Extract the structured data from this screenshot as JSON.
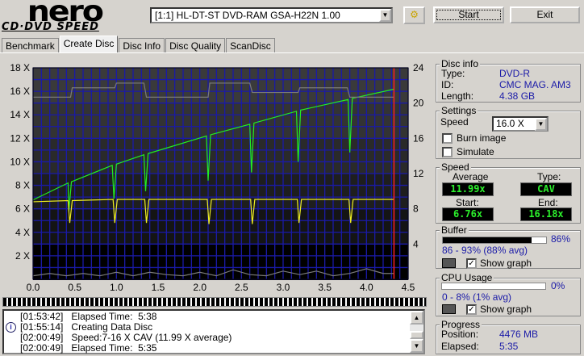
{
  "logo": {
    "line1": "nero",
    "line2": "CD·DVD SPEED"
  },
  "toolbar": {
    "drive": "[1:1]   HL-DT-ST DVD-RAM GSA-H22N 1.00",
    "start": "Start",
    "exit": "Exit",
    "icon": "drives-icon"
  },
  "tabs": [
    {
      "label": "Benchmark"
    },
    {
      "label": "Create Disc",
      "active": true
    },
    {
      "label": "Disc Info"
    },
    {
      "label": "Disc Quality"
    },
    {
      "label": "ScanDisc"
    }
  ],
  "disc_info": {
    "title": "Disc info",
    "type_label": "Type:",
    "type": "DVD-R",
    "id_label": "ID:",
    "id": "CMC MAG. AM3",
    "length_label": "Length:",
    "length": "4.38 GB"
  },
  "settings": {
    "title": "Settings",
    "speed_label": "Speed",
    "speed": "16.0 X",
    "burn_image": "Burn image",
    "burn_checked": false,
    "simulate": "Simulate",
    "simulate_checked": false
  },
  "speed": {
    "title": "Speed",
    "average_label": "Average",
    "average": "11.99x",
    "type_label": "Type:",
    "type": "CAV",
    "start_label": "Start:",
    "start": "6.76x",
    "end_label": "End:",
    "end": "16.18x"
  },
  "buffer": {
    "title": "Buffer",
    "percent": "86%",
    "level": 86,
    "range": "86 - 93% (88% avg)",
    "show_graph": "Show graph",
    "checked": true
  },
  "cpu": {
    "title": "CPU Usage",
    "percent": "0%",
    "level": 0,
    "range": "0 - 8% (1% avg)",
    "show_graph": "Show graph",
    "checked": true
  },
  "progress": {
    "title": "Progress",
    "position_label": "Position:",
    "position": "4476 MB",
    "elapsed_label": "Elapsed:",
    "elapsed": "5:35"
  },
  "log": [
    {
      "time": "[01:53:42]",
      "text": "Elapsed Time:  5:38",
      "icon": ""
    },
    {
      "time": "[01:55:14]",
      "text": "Creating Data Disc",
      "icon": "info-icon"
    },
    {
      "time": "[02:00:49]",
      "text": "Speed:7-16 X CAV (11.99 X average)",
      "icon": ""
    },
    {
      "time": "[02:00:49]",
      "text": "Elapsed Time:  5:35",
      "icon": ""
    }
  ],
  "colors": {
    "grid": "#1a1aa8",
    "speed": "#22ee22",
    "yellow": "#eeee22",
    "gray": "#7a7a7a",
    "marker": "#ff2020"
  },
  "chart_data": {
    "type": "line",
    "xlim": [
      0,
      4.5
    ],
    "ylim": [
      0,
      18
    ],
    "y2lim": [
      0,
      24
    ],
    "xticks": [
      "0.0",
      "0.5",
      "1.0",
      "1.5",
      "2.0",
      "2.5",
      "3.0",
      "3.5",
      "4.0",
      "4.5"
    ],
    "yticks": [
      "2 X",
      "4 X",
      "6 X",
      "8 X",
      "10 X",
      "12 X",
      "14 X",
      "16 X",
      "18 X"
    ],
    "y2ticks": [
      "4",
      "8",
      "12",
      "16",
      "20",
      "24"
    ],
    "grid": true,
    "end_marker_x": 4.33,
    "series": [
      {
        "color": "#22ee22",
        "points": [
          [
            0,
            6.76
          ],
          [
            0.42,
            8.2
          ],
          [
            0.43,
            5.8
          ],
          [
            0.46,
            8.3
          ],
          [
            0.95,
            9.7
          ],
          [
            0.97,
            6.85
          ],
          [
            1.0,
            9.8
          ],
          [
            1.33,
            10.6
          ],
          [
            1.35,
            7.5
          ],
          [
            1.38,
            10.7
          ],
          [
            2.08,
            12.2
          ],
          [
            2.1,
            8.4
          ],
          [
            2.13,
            12.3
          ],
          [
            2.6,
            13.2
          ],
          [
            2.62,
            9.1
          ],
          [
            2.65,
            13.3
          ],
          [
            3.16,
            14.3
          ],
          [
            3.18,
            10.0
          ],
          [
            3.21,
            14.4
          ],
          [
            3.78,
            15.3
          ],
          [
            3.8,
            10.8
          ],
          [
            3.83,
            15.4
          ],
          [
            4.33,
            16.18
          ]
        ]
      },
      {
        "color": "#eeee22",
        "points": [
          [
            0,
            6.6
          ],
          [
            0.42,
            6.7
          ],
          [
            0.44,
            4.8
          ],
          [
            0.47,
            6.7
          ],
          [
            0.96,
            6.8
          ],
          [
            0.98,
            4.8
          ],
          [
            1.01,
            6.8
          ],
          [
            1.34,
            6.8
          ],
          [
            1.36,
            4.8
          ],
          [
            1.39,
            6.8
          ],
          [
            2.09,
            6.8
          ],
          [
            2.11,
            4.7
          ],
          [
            2.14,
            6.8
          ],
          [
            2.61,
            6.8
          ],
          [
            2.63,
            4.7
          ],
          [
            2.66,
            6.8
          ],
          [
            3.17,
            6.8
          ],
          [
            3.19,
            4.8
          ],
          [
            3.22,
            6.8
          ],
          [
            3.79,
            6.8
          ],
          [
            3.81,
            4.8
          ],
          [
            3.84,
            6.8
          ],
          [
            4.33,
            6.8
          ]
        ]
      },
      {
        "color": "#7a7a7a",
        "points": [
          [
            0,
            15.5
          ],
          [
            0.45,
            15.5
          ],
          [
            0.47,
            16.3
          ],
          [
            0.98,
            16.3
          ],
          [
            1.0,
            16.7
          ],
          [
            1.33,
            16.7
          ],
          [
            1.36,
            15.5
          ],
          [
            2.1,
            15.5
          ],
          [
            2.12,
            16.7
          ],
          [
            2.6,
            16.7
          ],
          [
            2.63,
            15.9
          ],
          [
            3.18,
            15.9
          ],
          [
            3.2,
            16.3
          ],
          [
            3.77,
            16.3
          ],
          [
            3.8,
            15.5
          ],
          [
            4.33,
            15.5
          ]
        ]
      },
      {
        "color": "#7a7a7a",
        "points": [
          [
            0,
            0.3
          ],
          [
            0.2,
            0.5
          ],
          [
            0.4,
            0.3
          ],
          [
            0.6,
            0.5
          ],
          [
            0.8,
            0.3
          ],
          [
            1.0,
            0.6
          ],
          [
            1.2,
            0.3
          ],
          [
            1.4,
            0.6
          ],
          [
            1.6,
            0.4
          ],
          [
            1.8,
            0.3
          ],
          [
            2.0,
            0.6
          ],
          [
            2.2,
            0.3
          ],
          [
            2.4,
            0.8
          ],
          [
            2.6,
            0.4
          ],
          [
            2.8,
            0.3
          ],
          [
            3.0,
            0.7
          ],
          [
            3.2,
            0.4
          ],
          [
            3.4,
            0.7
          ],
          [
            3.6,
            0.3
          ],
          [
            3.8,
            0.5
          ],
          [
            4.0,
            0.9
          ],
          [
            4.2,
            0.5
          ],
          [
            4.33,
            0.5
          ]
        ]
      }
    ]
  }
}
